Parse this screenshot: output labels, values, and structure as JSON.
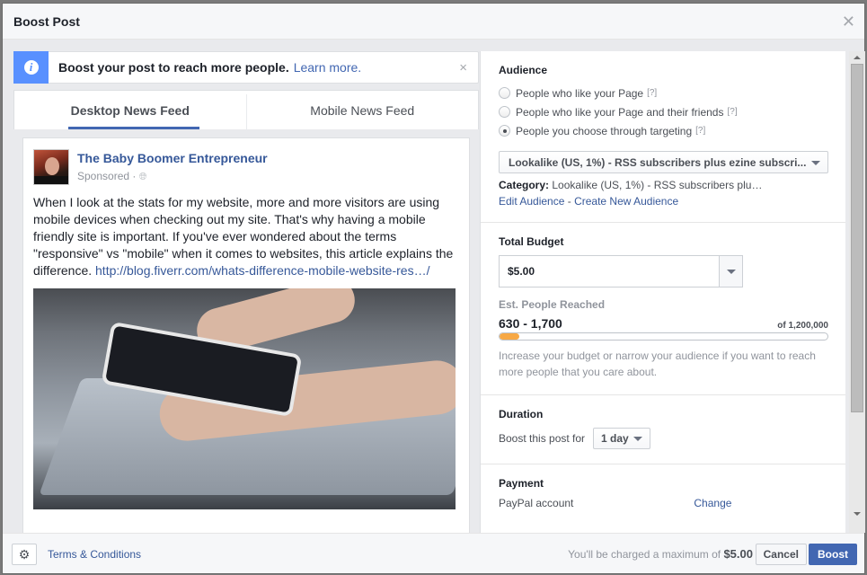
{
  "dialog": {
    "title": "Boost Post",
    "close_icon": "close-icon"
  },
  "notice": {
    "icon": "info-icon",
    "message": "Boost your post to reach more people.",
    "link": "Learn more.",
    "close": "×"
  },
  "tabs": [
    {
      "label": "Desktop News Feed",
      "active": true
    },
    {
      "label": "Mobile News Feed",
      "active": false
    }
  ],
  "post": {
    "page_name": "The Baby Boomer Entrepreneur",
    "sponsored": "Sponsored ·",
    "audience_icon": "globe-icon",
    "text": "When I look at the stats for my website, more and more visitors are using mobile devices when checking out my site. That's why having a mobile friendly site is important. If you've ever wondered about the terms \"responsive\" vs \"mobile\" when it comes to websites, this article explains the difference.",
    "link": "http://blog.fiverr.com/whats-difference-mobile-website-res…/",
    "image_alt": "Hands holding a smartphone over a notebook"
  },
  "audience": {
    "heading": "Audience",
    "options": [
      {
        "label": "People who like your Page",
        "help": "[?]",
        "checked": false
      },
      {
        "label": "People who like your Page and their friends",
        "help": "[?]",
        "checked": false
      },
      {
        "label": "People you choose through targeting",
        "help": "[?]",
        "checked": true
      }
    ],
    "selected": "Lookalike (US, 1%) - RSS subscribers plus ezine subscri...",
    "category_label": "Category:",
    "category_value": "Lookalike (US, 1%) - RSS subscribers plu…",
    "edit_link": "Edit Audience",
    "separator": "-",
    "create_link": "Create New Audience"
  },
  "budget": {
    "heading": "Total Budget",
    "value": "$5.00",
    "est_label": "Est. People Reached",
    "reach_range": "630 - 1,700",
    "reach_total": "of 1,200,000",
    "reach_fraction": 0.06,
    "hint": "Increase your budget or narrow your audience if you want to reach more people that you care about."
  },
  "duration": {
    "heading": "Duration",
    "label": "Boost this post for",
    "value": "1 day"
  },
  "payment": {
    "heading": "Payment",
    "method": "PayPal account",
    "change": "Change"
  },
  "footer": {
    "terms": "Terms & Conditions",
    "charge_prefix": "You'll be charged a maximum of",
    "charge_amount": "$5.00",
    "cancel": "Cancel",
    "boost": "Boost"
  }
}
